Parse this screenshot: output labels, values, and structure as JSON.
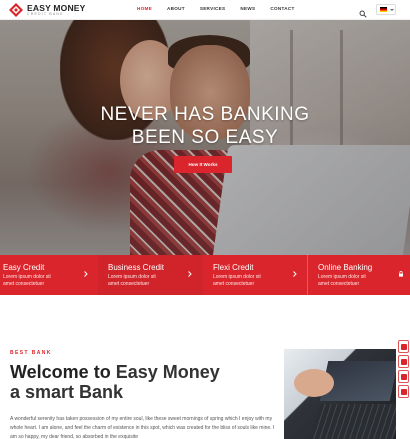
{
  "header": {
    "logo_title": "EASY MONEY",
    "logo_subtitle": "CREDIT BANK",
    "nav": [
      "HOME",
      "ABOUT",
      "SERVICES",
      "NEWS",
      "CONTACT"
    ],
    "active_nav": "HOME",
    "search_icon": "search-icon",
    "language_flag": "german-flag-icon"
  },
  "hero": {
    "title_line1": "NEVER HAS BANKING",
    "title_line2": "BEEN SO EASY",
    "button_label": "How It Works"
  },
  "features": [
    {
      "title": "Easy Credit",
      "desc_line1": "Lorem ipsum dolor sit",
      "desc_line2": "amet consectetuer",
      "icon": "chevron-right-icon"
    },
    {
      "title": "Business Credit",
      "desc_line1": "Lorem ipsum dolor sit",
      "desc_line2": "amet consectetuer",
      "icon": "chevron-right-icon"
    },
    {
      "title": "Flexi Credit",
      "desc_line1": "Lorem ipsum dolor sit",
      "desc_line2": "amet consectetuer",
      "icon": "chevron-right-icon"
    },
    {
      "title": "Online Banking",
      "desc_line1": "Lorem ipsum dolor sit",
      "desc_line2": "amet consectetuer",
      "icon": "lock-icon"
    }
  ],
  "intro": {
    "eyebrow": "BEST BANK",
    "heading_bold": "Welcome to",
    "heading_rest": "Easy Money",
    "heading_line2": "a smart Bank",
    "paragraph": "A wonderful serenity has taken possession of my entire soul, like these sweet mornings of spring which I enjoy with my whole heart. I am alone, and feel the charm of existence in this spot, which was created for the bliss of souls like mine. I am so happy, my dear friend, so absorbed in the exquisite"
  },
  "colors": {
    "accent": "#d9252b",
    "text": "#333333"
  },
  "side_toolbar": [
    "document-icon",
    "gift-icon",
    "tag-icon",
    "cart-icon"
  ]
}
